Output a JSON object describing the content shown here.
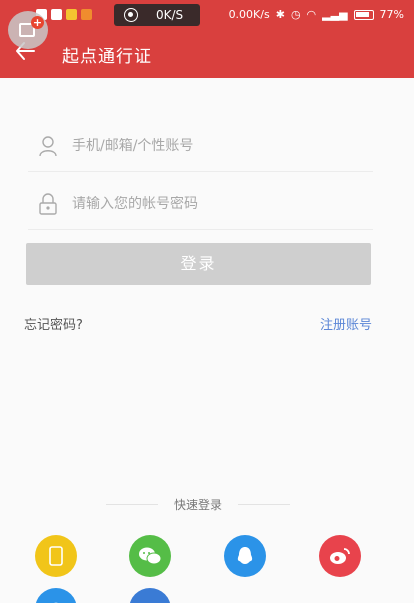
{
  "statusbar": {
    "net_speed_pill": "0K/S",
    "net_speed": "0.00K/s",
    "battery": "77%"
  },
  "header": {
    "title": "起点通行证"
  },
  "login": {
    "username_placeholder": "手机/邮箱/个性账号",
    "password_placeholder": "请输入您的帐号密码",
    "login_button": "登录",
    "forgot_password": "忘记密码?",
    "register": "注册账号"
  },
  "quick_login": {
    "label": "快速登录",
    "providers": [
      "phone",
      "wechat",
      "qq",
      "weibo"
    ]
  },
  "colors": {
    "brand_red": "#d9403e",
    "disabled_button": "#cfcfcf",
    "link_blue": "#5b86d6"
  }
}
